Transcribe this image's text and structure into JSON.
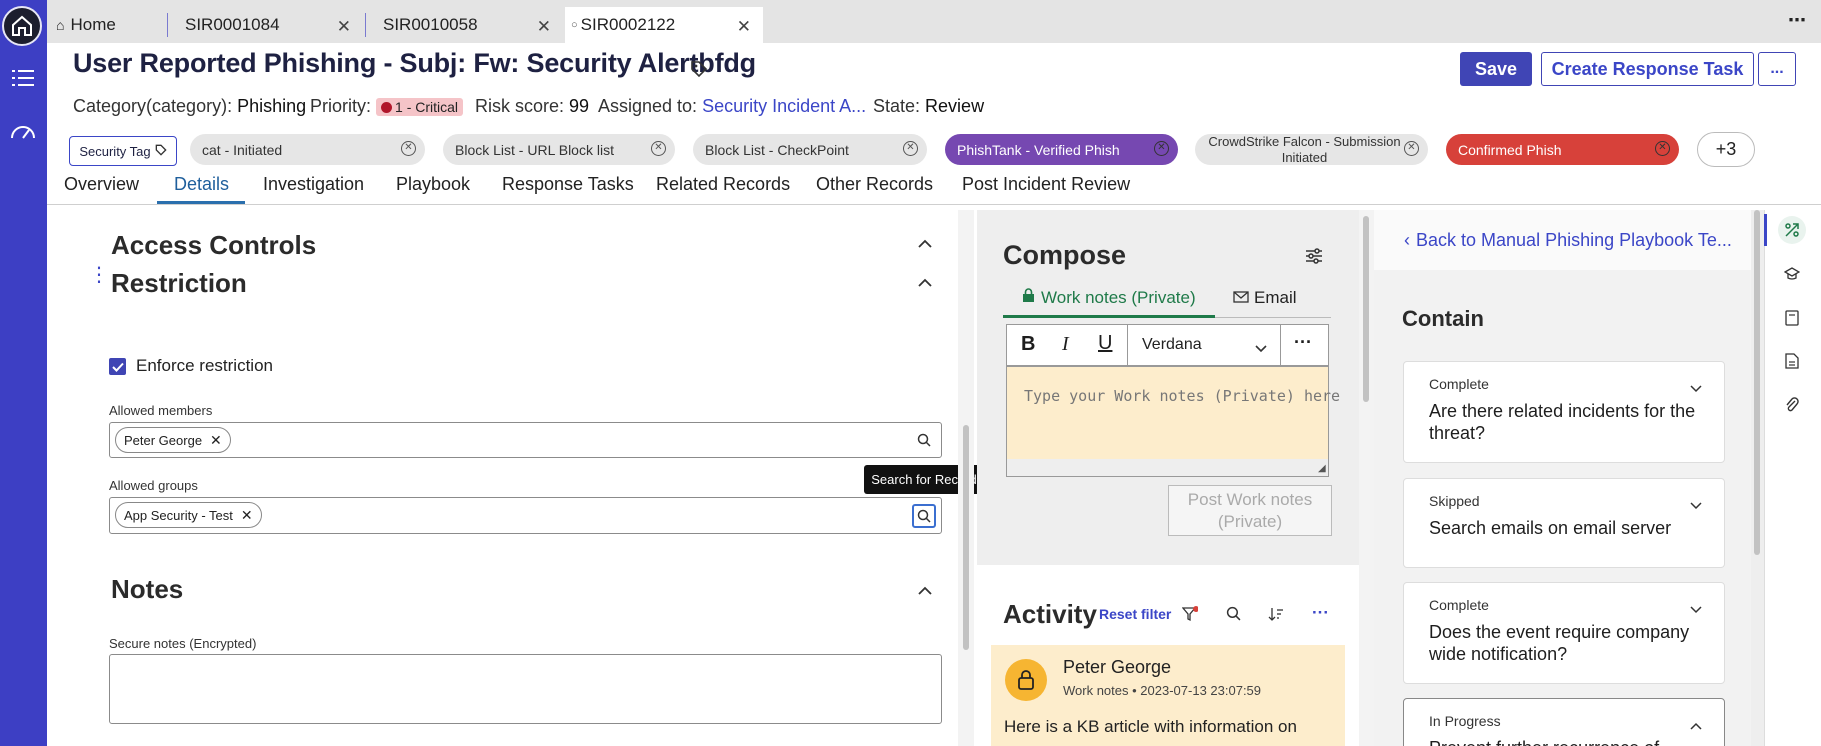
{
  "tabs": {
    "home": "Home",
    "tab1": "SIR0001084",
    "tab2": "SIR0010058",
    "tab3": "SIR0002122"
  },
  "header": {
    "title": "User Reported Phishing - Subj: Fw: Security Alertbfdg",
    "category_label": "Category(category):",
    "category_value": "Phishing",
    "priority_label": "Priority:",
    "priority_value": "1 - Critical",
    "risk_label": "Risk score:",
    "risk_value": "99",
    "assigned_label": "Assigned to:",
    "assigned_value": "Security Incident A...",
    "state_label": "State:",
    "state_value": "Review",
    "save": "Save",
    "create_task": "Create Response Task",
    "more": "..."
  },
  "tags": {
    "security_tag": "Security Tag",
    "items": [
      "cat - Initiated",
      "Block List - URL Block list",
      "Block List - CheckPoint",
      "PhishTank - Verified Phish",
      "CrowdStrike Falcon - Submission Initiated",
      "Confirmed Phish"
    ],
    "more": "+3"
  },
  "nav": [
    "Overview",
    "Details",
    "Investigation",
    "Playbook",
    "Response Tasks",
    "Related Records",
    "Other Records",
    "Post Incident Review"
  ],
  "form": {
    "access_controls": "Access Controls",
    "restriction": "Restriction",
    "enforce": "Enforce restriction",
    "allowed_members_label": "Allowed members",
    "allowed_members": [
      "Peter George"
    ],
    "allowed_groups_label": "Allowed groups",
    "allowed_groups": [
      "App Security - Test"
    ],
    "tooltip": "Search for Record",
    "notes": "Notes",
    "secure_notes_label": "Secure notes (Encrypted)"
  },
  "compose": {
    "title": "Compose",
    "tab_work": "Work notes (Private)",
    "tab_email": "Email",
    "font": "Verdana",
    "placeholder": "Type your Work notes (Private) here",
    "post": "Post Work notes (Private)"
  },
  "activity": {
    "title": "Activity",
    "reset": "Reset filter",
    "author": "Peter George",
    "type": "Work notes",
    "time": "2023-07-13 23:07:59",
    "text": "Here is a KB article with information on"
  },
  "playbook": {
    "back": "Back to Manual Phishing Playbook Te...",
    "section": "Contain",
    "cards": [
      {
        "status": "Complete",
        "question": "Are there related incidents for the threat?"
      },
      {
        "status": "Skipped",
        "question": "Search emails on email server"
      },
      {
        "status": "Complete",
        "question": "Does the event require company wide notification?"
      },
      {
        "status": "In Progress",
        "question": "Prevent further recurrence of"
      }
    ]
  },
  "colors": {
    "rail": "#3d3fc4",
    "primary": "#4045b5",
    "link": "#3b46c7",
    "purple_chip": "#7648b1",
    "red_chip": "#d7413a",
    "work_notes_bg": "#fdedcc"
  }
}
